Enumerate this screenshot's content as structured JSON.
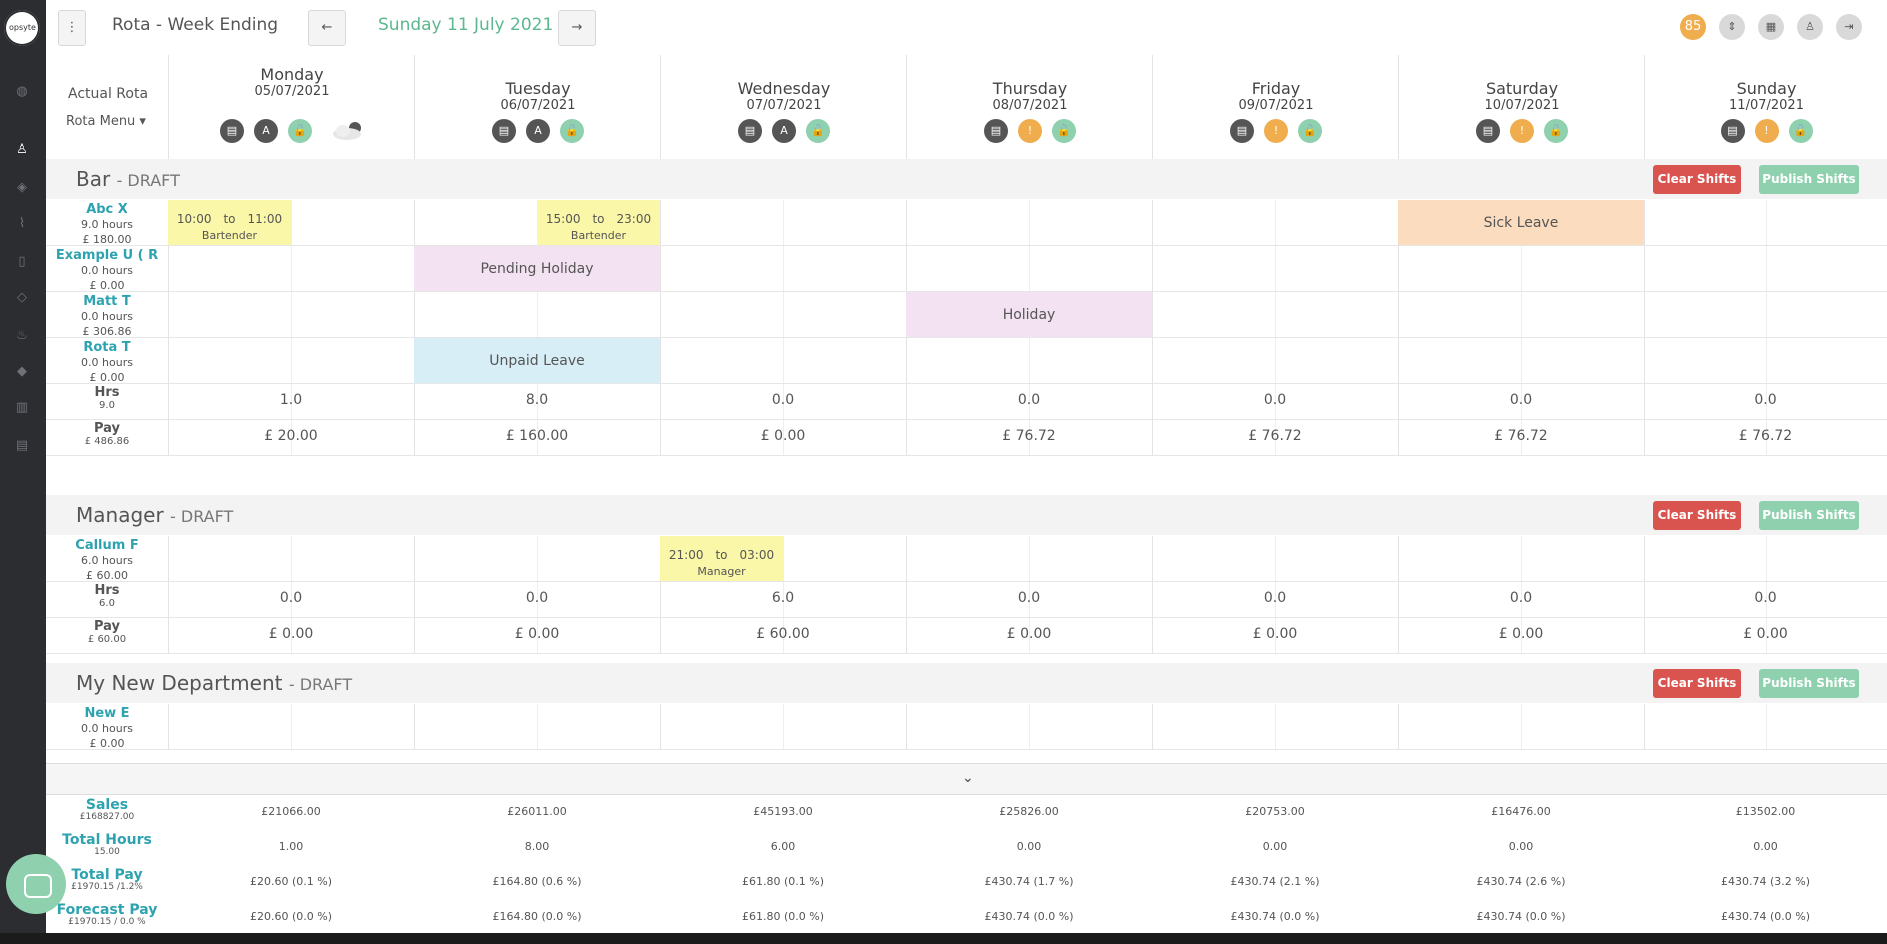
{
  "brand": {
    "logo_text": "opsyte"
  },
  "sidebar": {
    "icons": [
      "globe-icon",
      "user-icon",
      "layers-icon",
      "chart-line-icon",
      "book-icon",
      "tag-icon",
      "fire-icon",
      "diamond-icon",
      "bar-chart-icon",
      "bar-chart-2-icon"
    ]
  },
  "header": {
    "menu_icon": "⋮",
    "title": "Rota - Week Ending",
    "prev_icon": "←",
    "date": "Sunday 11 July 2021",
    "next_icon": "→",
    "notifications": "85"
  },
  "grid": {
    "actual_rota": "Actual Rota",
    "rota_menu": "Rota Menu ▾",
    "days": [
      {
        "name": "Monday",
        "date": "05/07/2021",
        "status": "A",
        "status_color": "dark"
      },
      {
        "name": "Tuesday",
        "date": "06/07/2021",
        "status": "A",
        "status_color": "dark"
      },
      {
        "name": "Wednesday",
        "date": "07/07/2021",
        "status": "A",
        "status_color": "dark"
      },
      {
        "name": "Thursday",
        "date": "08/07/2021",
        "status": "!",
        "status_color": "orange"
      },
      {
        "name": "Friday",
        "date": "09/07/2021",
        "status": "!",
        "status_color": "orange"
      },
      {
        "name": "Saturday",
        "date": "10/07/2021",
        "status": "!",
        "status_color": "orange"
      },
      {
        "name": "Sunday",
        "date": "11/07/2021",
        "status": "!",
        "status_color": "orange"
      }
    ]
  },
  "buttons": {
    "clear": "Clear Shifts",
    "publish": "Publish Shifts"
  },
  "departments": [
    {
      "name": "Bar",
      "status": "- DRAFT",
      "employees": [
        {
          "name": "Abc X",
          "hours": "9.0 hours",
          "pay": "£ 180.00"
        },
        {
          "name": "Example U ( R",
          "hours": "0.0 hours",
          "pay": "£ 0.00"
        },
        {
          "name": "Matt T",
          "hours": "0.0 hours",
          "pay": "£ 306.86"
        },
        {
          "name": "Rota T",
          "hours": "0.0 hours",
          "pay": "£ 0.00"
        }
      ],
      "shifts": [
        {
          "time_from": "10:00",
          "to": "to",
          "time_to": "11:00",
          "role": "Bartender"
        },
        {
          "time_from": "15:00",
          "to": "to",
          "time_to": "23:00",
          "role": "Bartender"
        }
      ],
      "leave": {
        "sick": "Sick Leave",
        "pending": "Pending Holiday",
        "holiday": "Holiday",
        "unpaid": "Unpaid Leave"
      },
      "hrs_label": "Hrs",
      "hrs_total": "9.0",
      "pay_label": "Pay",
      "pay_total": "£ 486.86",
      "hrs": [
        "1.0",
        "8.0",
        "0.0",
        "0.0",
        "0.0",
        "0.0",
        "0.0"
      ],
      "pay": [
        "£ 20.00",
        "£ 160.00",
        "£ 0.00",
        "£ 76.72",
        "£ 76.72",
        "£ 76.72",
        "£ 76.72"
      ]
    },
    {
      "name": "Manager",
      "status": "- DRAFT",
      "employees": [
        {
          "name": "Callum F",
          "hours": "6.0 hours",
          "pay": "£ 60.00"
        }
      ],
      "shifts": [
        {
          "time_from": "21:00",
          "to": "to",
          "time_to": "03:00",
          "role": "Manager"
        }
      ],
      "hrs_label": "Hrs",
      "hrs_total": "6.0",
      "pay_label": "Pay",
      "pay_total": "£ 60.00",
      "hrs": [
        "0.0",
        "0.0",
        "6.0",
        "0.0",
        "0.0",
        "0.0",
        "0.0"
      ],
      "pay": [
        "£ 0.00",
        "£ 0.00",
        "£ 60.00",
        "£ 0.00",
        "£ 0.00",
        "£ 0.00",
        "£ 0.00"
      ]
    },
    {
      "name": "My New Department",
      "status": "- DRAFT",
      "employees": [
        {
          "name": "New E",
          "hours": "0.0 hours",
          "pay": "£ 0.00"
        }
      ]
    }
  ],
  "financials": [
    {
      "label": "Sales",
      "total": "£168827.00",
      "values": [
        "£21066.00",
        "£26011.00",
        "£45193.00",
        "£25826.00",
        "£20753.00",
        "£16476.00",
        "£13502.00"
      ]
    },
    {
      "label": "Total Hours",
      "total": "15.00",
      "values": [
        "1.00",
        "8.00",
        "6.00",
        "0.00",
        "0.00",
        "0.00",
        "0.00"
      ]
    },
    {
      "label": "Total Pay",
      "total": "£1970.15 /1.2%",
      "values": [
        "£20.60 (0.1 %)",
        "£164.80 (0.6 %)",
        "£61.80 (0.1 %)",
        "£430.74 (1.7 %)",
        "£430.74 (2.1 %)",
        "£430.74 (2.6 %)",
        "£430.74 (3.2 %)"
      ]
    },
    {
      "label": "Forecast Pay",
      "total": "£1970.15 / 0.0 %",
      "values": [
        "£20.60 (0.0 %)",
        "£164.80 (0.0 %)",
        "£61.80 (0.0 %)",
        "£430.74 (0.0 %)",
        "£430.74 (0.0 %)",
        "£430.74 (0.0 %)",
        "£430.74 (0.0 %)"
      ]
    }
  ]
}
